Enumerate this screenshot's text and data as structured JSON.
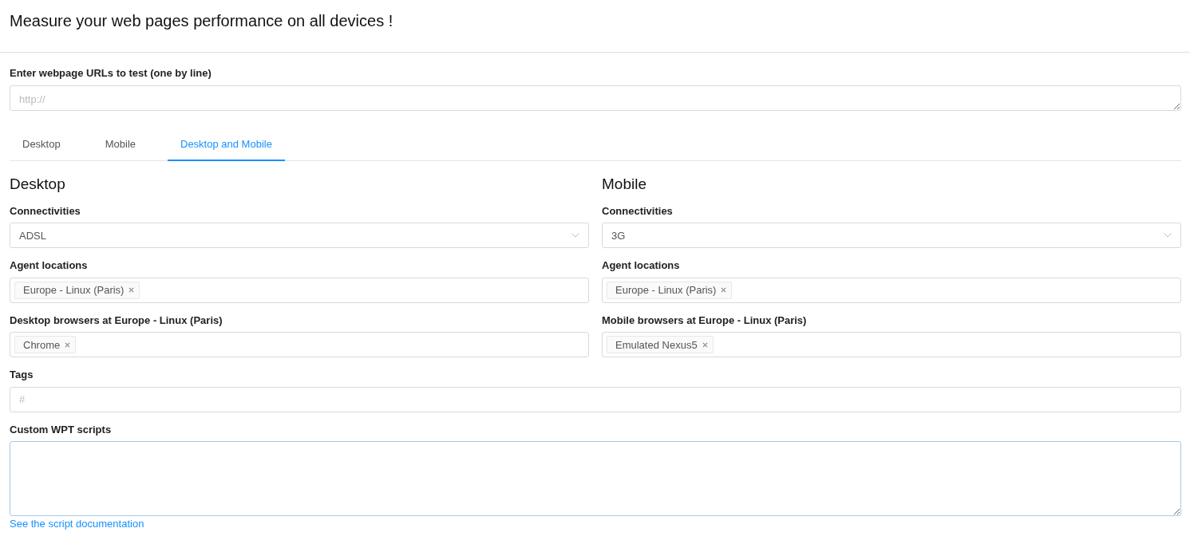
{
  "title": "Measure your web pages performance on all devices !",
  "urls": {
    "label": "Enter webpage URLs to test (one by line)",
    "placeholder": "http://"
  },
  "tabs": [
    {
      "label": "Desktop",
      "selected": false
    },
    {
      "label": "Mobile",
      "selected": false
    },
    {
      "label": "Desktop and Mobile",
      "selected": true
    }
  ],
  "columns": [
    {
      "heading": "Desktop",
      "connectivity": {
        "label": "Connectivities",
        "value": "ADSL"
      },
      "locations": {
        "label": "Agent locations",
        "tags": [
          "Europe - Linux (Paris)"
        ]
      },
      "browsers": {
        "label": "Desktop browsers at Europe - Linux (Paris)",
        "tags": [
          "Chrome"
        ]
      }
    },
    {
      "heading": "Mobile",
      "connectivity": {
        "label": "Connectivities",
        "value": "3G"
      },
      "locations": {
        "label": "Agent locations",
        "tags": [
          "Europe - Linux (Paris)"
        ]
      },
      "browsers": {
        "label": "Mobile browsers at Europe - Linux (Paris)",
        "tags": [
          "Emulated Nexus5"
        ]
      }
    }
  ],
  "tags": {
    "label": "Tags",
    "placeholder": "#"
  },
  "scripts": {
    "label": "Custom WPT scripts"
  },
  "doc_link": "See the script documentation"
}
